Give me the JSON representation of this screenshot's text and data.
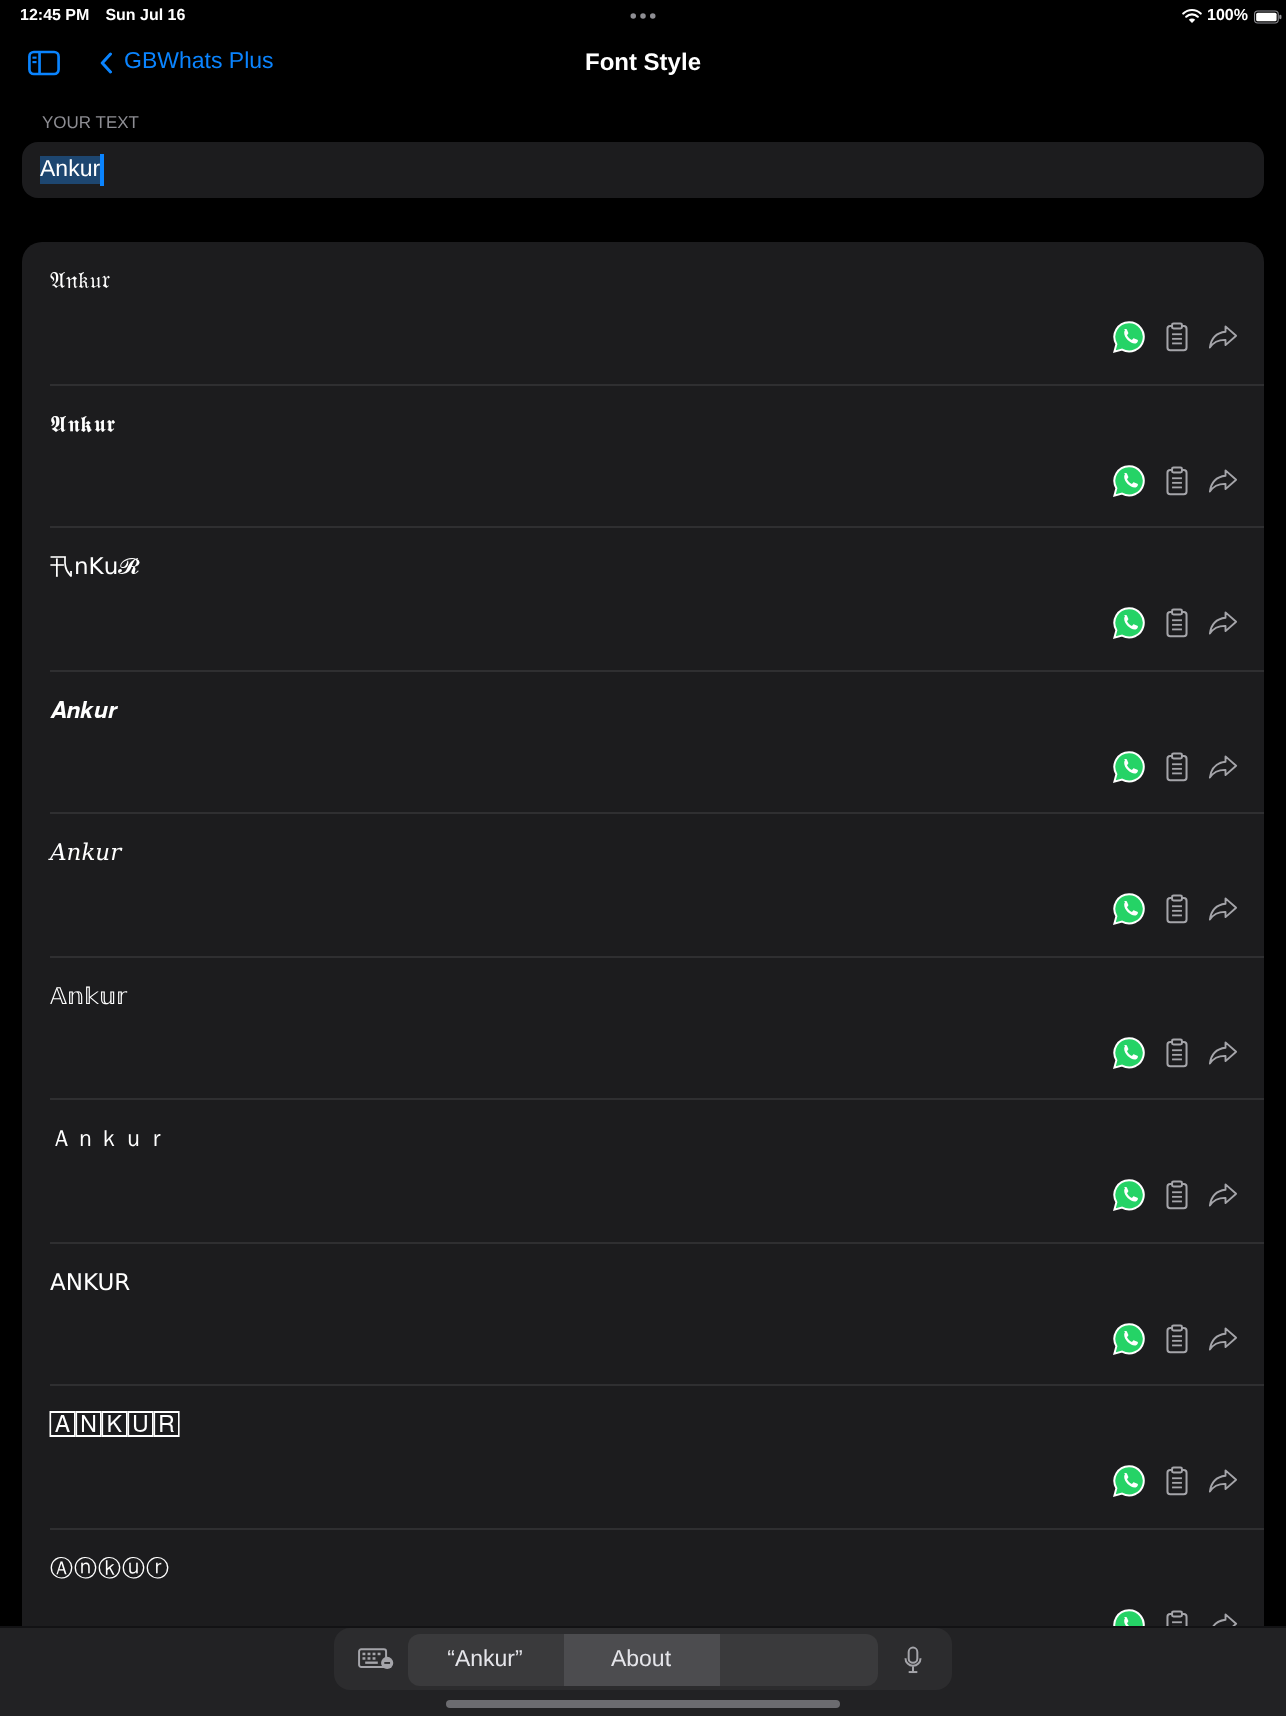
{
  "status_bar": {
    "time": "12:45 PM",
    "date": "Sun Jul 16",
    "battery": "100%"
  },
  "nav_bar": {
    "back_label": "GBWhats Plus",
    "title": "Font Style"
  },
  "text_input": {
    "label": "YOUR TEXT",
    "value": "Ankur",
    "text_selected": true
  },
  "font_styles": [
    {
      "text": "𝔄𝔫𝔨𝔲𝔯"
    },
    {
      "text": "𝕬𝖓𝖐𝖚𝖗"
    },
    {
      "text": "卂n𝖪u𝓡"
    },
    {
      "text": "𝑨𝒏𝒌𝒖𝒓"
    },
    {
      "text": "𝐴𝑛𝑘𝑢𝑟"
    },
    {
      "text": "𝔸𝕟𝕜𝕦𝕣"
    },
    {
      "text": "Ａｎｋｕｒ"
    },
    {
      "text": "ANKUR"
    },
    {
      "text": "🄰🄽🄺🅄🅁"
    },
    {
      "text": "Ⓐⓝⓚⓤⓡ"
    }
  ],
  "keyboard_bar": {
    "suggestions": [
      {
        "text": "“Ankur”",
        "selected": false
      },
      {
        "text": "About",
        "selected": true
      }
    ]
  }
}
